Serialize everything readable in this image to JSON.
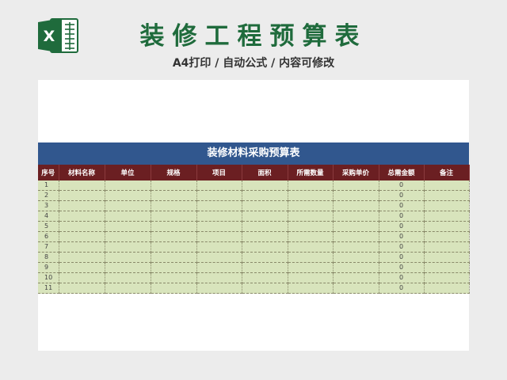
{
  "header": {
    "title": "装修工程预算表",
    "subtitle": "A4打印 / 自动公式 / 内容可修改",
    "logo_icon": "excel-icon",
    "logo_letter": "X",
    "logo_color": "#1f6b3c"
  },
  "sheet": {
    "table_title": "装修材料采购预算表",
    "banner_color": "#31578e",
    "header_color": "#6b1f22",
    "cell_color": "#d8e4bc",
    "columns": [
      "序号",
      "材料名称",
      "单位",
      "规格",
      "项目",
      "面积",
      "所需数量",
      "采购单价",
      "总需金额",
      "备注"
    ],
    "rows": [
      {
        "no": "1",
        "total": "0"
      },
      {
        "no": "2",
        "total": "0"
      },
      {
        "no": "3",
        "total": "0"
      },
      {
        "no": "4",
        "total": "0"
      },
      {
        "no": "5",
        "total": "0"
      },
      {
        "no": "6",
        "total": "0"
      },
      {
        "no": "7",
        "total": "0"
      },
      {
        "no": "8",
        "total": "0"
      },
      {
        "no": "9",
        "total": "0"
      },
      {
        "no": "10",
        "total": "0"
      },
      {
        "no": "11",
        "total": "0"
      }
    ]
  }
}
